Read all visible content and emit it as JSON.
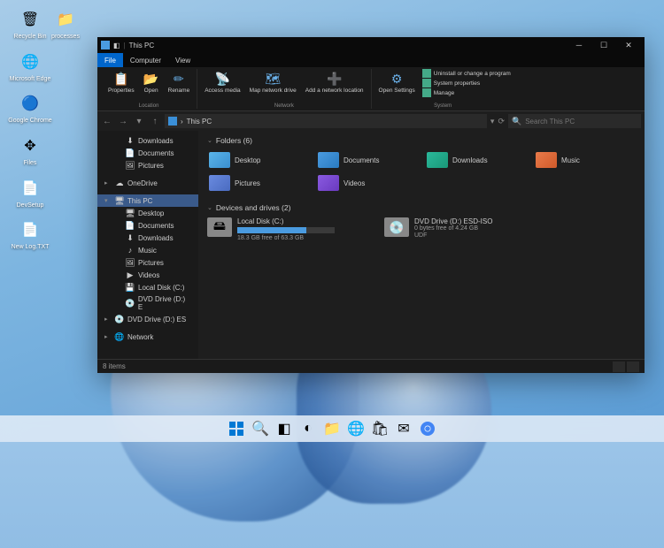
{
  "desktop": {
    "icons": [
      {
        "label": "Recycle Bin",
        "icon": "recycle"
      },
      {
        "label": "Microsoft Edge",
        "icon": "edge"
      },
      {
        "label": "Google Chrome",
        "icon": "chrome"
      },
      {
        "label": "Files",
        "icon": "files"
      },
      {
        "label": "DevSetup",
        "icon": "file"
      },
      {
        "label": "New Log.TXT",
        "icon": "file"
      }
    ],
    "icons2": [
      {
        "label": "processes",
        "icon": "folder"
      }
    ]
  },
  "explorer": {
    "titlebar": {
      "title": "This PC"
    },
    "tabs": [
      {
        "label": "File",
        "active": true
      },
      {
        "label": "Computer",
        "active": false
      },
      {
        "label": "View",
        "active": false
      }
    ],
    "ribbon": {
      "location": {
        "label": "Location",
        "items": [
          {
            "label": "Properties"
          },
          {
            "label": "Open"
          },
          {
            "label": "Rename"
          }
        ]
      },
      "network": {
        "label": "Network",
        "items": [
          {
            "label": "Access media"
          },
          {
            "label": "Map network drive"
          },
          {
            "label": "Add a network location"
          }
        ]
      },
      "system": {
        "label": "System",
        "open_settings": "Open Settings",
        "items": [
          {
            "label": "Uninstall or change a program"
          },
          {
            "label": "System properties"
          },
          {
            "label": "Manage"
          }
        ]
      }
    },
    "address": {
      "path": "This PC"
    },
    "search": {
      "placeholder": "Search This PC"
    },
    "sidebar": {
      "items": [
        {
          "label": "Downloads",
          "icon": "⬇",
          "indent": 1
        },
        {
          "label": "Documents",
          "icon": "📄",
          "indent": 1
        },
        {
          "label": "Pictures",
          "icon": "🖼",
          "indent": 1
        },
        {
          "label": "",
          "sep": true
        },
        {
          "label": "OneDrive",
          "icon": "☁",
          "indent": 0,
          "chev": "▸"
        },
        {
          "label": "",
          "sep": true
        },
        {
          "label": "This PC",
          "icon": "🖥",
          "indent": 0,
          "chev": "▾",
          "sel": true
        },
        {
          "label": "Desktop",
          "icon": "🖥",
          "indent": 1
        },
        {
          "label": "Documents",
          "icon": "📄",
          "indent": 1
        },
        {
          "label": "Downloads",
          "icon": "⬇",
          "indent": 1
        },
        {
          "label": "Music",
          "icon": "♪",
          "indent": 1
        },
        {
          "label": "Pictures",
          "icon": "🖼",
          "indent": 1
        },
        {
          "label": "Videos",
          "icon": "▶",
          "indent": 1
        },
        {
          "label": "Local Disk (C:)",
          "icon": "💾",
          "indent": 1
        },
        {
          "label": "DVD Drive (D:) E",
          "icon": "💿",
          "indent": 1
        },
        {
          "label": "DVD Drive (D:) ES",
          "icon": "💿",
          "indent": 0,
          "chev": "▸"
        },
        {
          "label": "",
          "sep": true
        },
        {
          "label": "Network",
          "icon": "🌐",
          "indent": 0,
          "chev": "▸"
        }
      ]
    },
    "content": {
      "folders_header": "Folders (6)",
      "folders": [
        {
          "label": "Desktop",
          "cls": "desktop"
        },
        {
          "label": "Documents",
          "cls": "documents"
        },
        {
          "label": "Downloads",
          "cls": "downloads"
        },
        {
          "label": "Music",
          "cls": "music"
        },
        {
          "label": "Pictures",
          "cls": "pictures"
        },
        {
          "label": "Videos",
          "cls": "videos"
        }
      ],
      "drives_header": "Devices and drives (2)",
      "drives": [
        {
          "name": "Local Disk (C:)",
          "sub": "18.3 GB free of 63.3 GB",
          "fill": 71
        },
        {
          "name": "DVD Drive (D:) ESD-ISO",
          "sub": "0 bytes free of 4.24 GB\nUDF",
          "fill": 0,
          "nobar": true
        }
      ]
    },
    "statusbar": {
      "text": "8 items"
    }
  },
  "taskbar": {
    "icons": [
      "start",
      "search",
      "taskview",
      "widgets",
      "explorer",
      "edge",
      "store",
      "mail",
      "chrome"
    ]
  }
}
